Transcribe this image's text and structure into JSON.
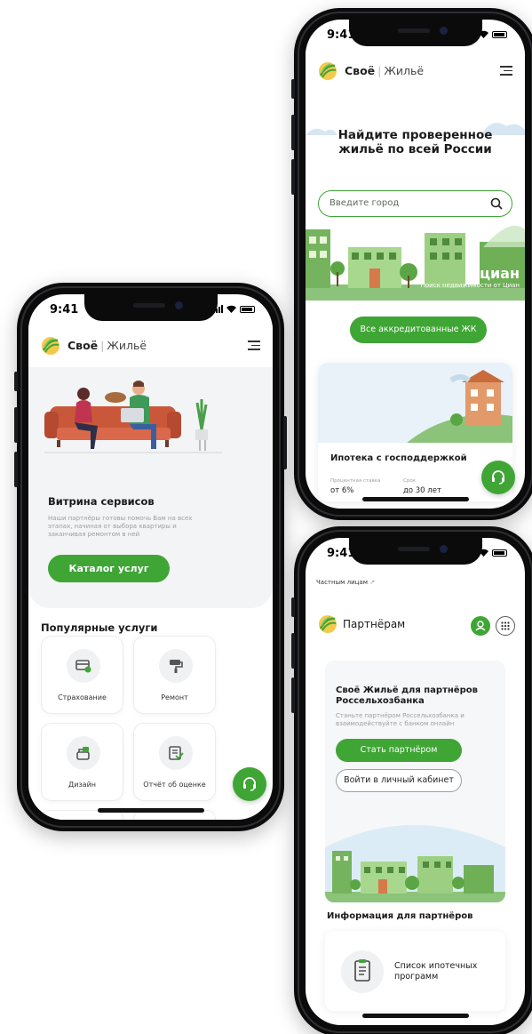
{
  "status": {
    "time": "9:41"
  },
  "brand": {
    "name": "Своё",
    "sub": "Жильё"
  },
  "left": {
    "services_title": "Витрина сервисов",
    "services_desc": "Наши партнёры готовы помочь Вам на всех этапах, начиная от выбора квартиры и заканчивая ремонтом в ней",
    "catalog_button": "Каталог услуг",
    "popular_title": "Популярные услуги",
    "tiles": [
      {
        "label": "Страхование",
        "icon": "insurance-icon"
      },
      {
        "label": "Ремонт",
        "icon": "paint-roller-icon"
      },
      {
        "label": "Дизайн",
        "icon": "design-icon"
      },
      {
        "label": "Отчёт об оценке",
        "icon": "report-icon"
      }
    ]
  },
  "topright": {
    "hero_title": "Найдите проверенное жильё по всей России",
    "search_placeholder": "Введите город",
    "cian_logo": "циан",
    "cian_sub": "Поиск недвижимости от Циан",
    "accredited_button": "Все аккредитованные ЖК",
    "mortgage_title": "Ипотека с господдержкой",
    "rate_label": "Процентная ставка",
    "rate_value": "от 6%",
    "term_label": "Срок",
    "term_value": "до 30 лет"
  },
  "bottomright": {
    "breadcrumb": "Частным лицам",
    "breadcrumb_arrow": "↗",
    "page_title": "Партнёрам",
    "card_title": "Своё Жильё для партнёров Россельхозбанка",
    "card_desc": "Станьте партнёром Россельхозбанка и взаимодействуйте с банком онлайн",
    "become_partner": "Стать партнёром",
    "login_cabinet": "Войти в личный кабинет",
    "info_title": "Информация для партнёров",
    "program_list": "Список ипотечных программ"
  },
  "colors": {
    "accent": "#3fa535",
    "light_bg": "#f3f4f5",
    "text": "#1f2328",
    "muted": "#9aa0a6"
  }
}
